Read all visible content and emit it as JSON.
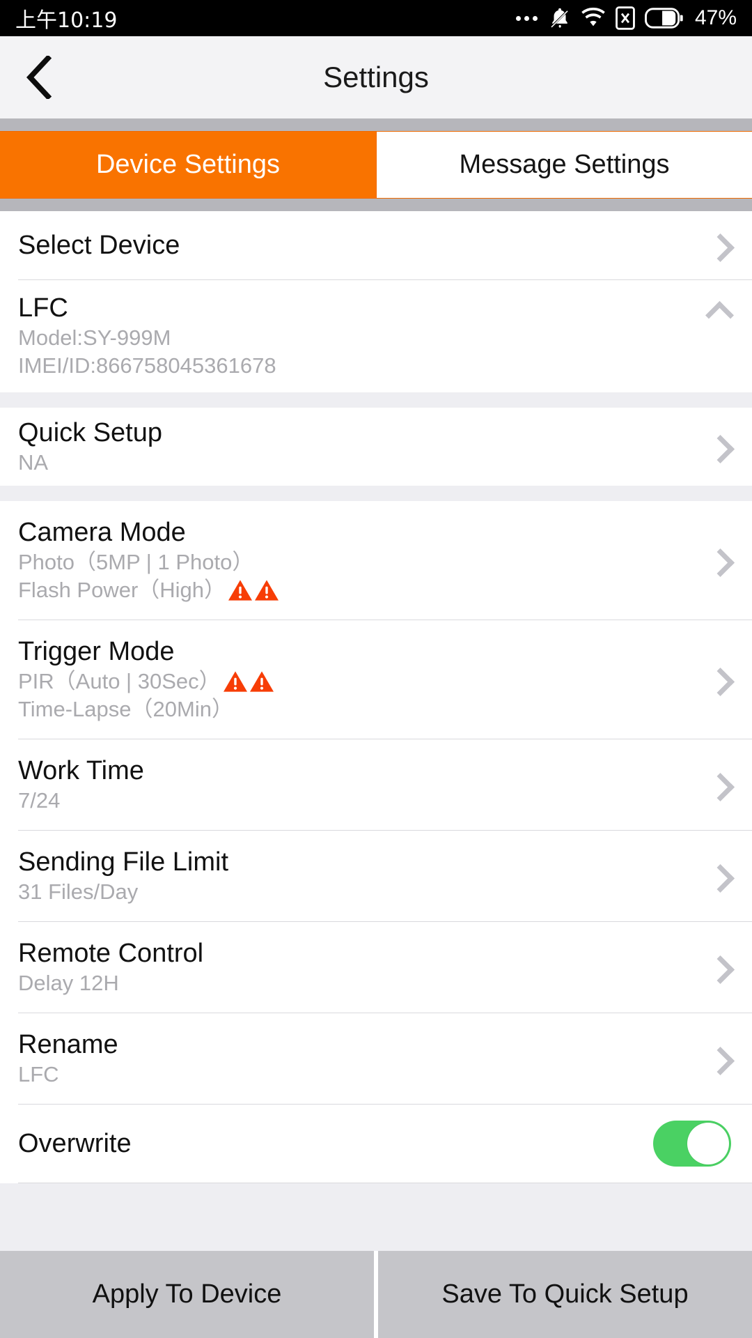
{
  "status_bar": {
    "time": "上午10:19",
    "battery_percent": "47%",
    "icons": [
      "more-dots-icon",
      "bell-muted-icon",
      "wifi-icon",
      "sim-x-icon",
      "battery-icon"
    ]
  },
  "header": {
    "title": "Settings",
    "back_icon": "back-chevron-icon"
  },
  "tabs": [
    {
      "label": "Device Settings",
      "active": true
    },
    {
      "label": "Message Settings",
      "active": false
    }
  ],
  "rows": {
    "select_device": {
      "title": "Select Device"
    },
    "device_info": {
      "name": "LFC",
      "model": "Model:SY-999M",
      "imei": "IMEI/ID:866758045361678",
      "collapse_icon": "chevron-up-icon"
    },
    "quick_setup": {
      "title": "Quick Setup",
      "value": "NA"
    },
    "camera_mode": {
      "title": "Camera Mode",
      "line1": "Photo（5MP | 1 Photo）",
      "line2": "Flash Power（High）",
      "warnings": 2
    },
    "trigger_mode": {
      "title": "Trigger Mode",
      "line1": "PIR（Auto | 30Sec）",
      "line2": "Time-Lapse（20Min）",
      "warnings": 2
    },
    "work_time": {
      "title": "Work Time",
      "value": "7/24"
    },
    "sending_file_limit": {
      "title": "Sending File Limit",
      "value": "31 Files/Day"
    },
    "remote_control": {
      "title": "Remote Control",
      "value": "Delay 12H"
    },
    "rename": {
      "title": "Rename",
      "value": "LFC"
    },
    "overwrite": {
      "title": "Overwrite",
      "toggle_state": "on"
    }
  },
  "bottom_buttons": {
    "apply": "Apply To Device",
    "save": "Save To Quick Setup"
  },
  "colors": {
    "accent_orange": "#f97300",
    "toggle_green": "#4ad163",
    "warning_red": "#f73d06",
    "muted_text": "#aaaaae",
    "page_bg": "#eeeef2",
    "button_gray": "#c5c5c9"
  }
}
